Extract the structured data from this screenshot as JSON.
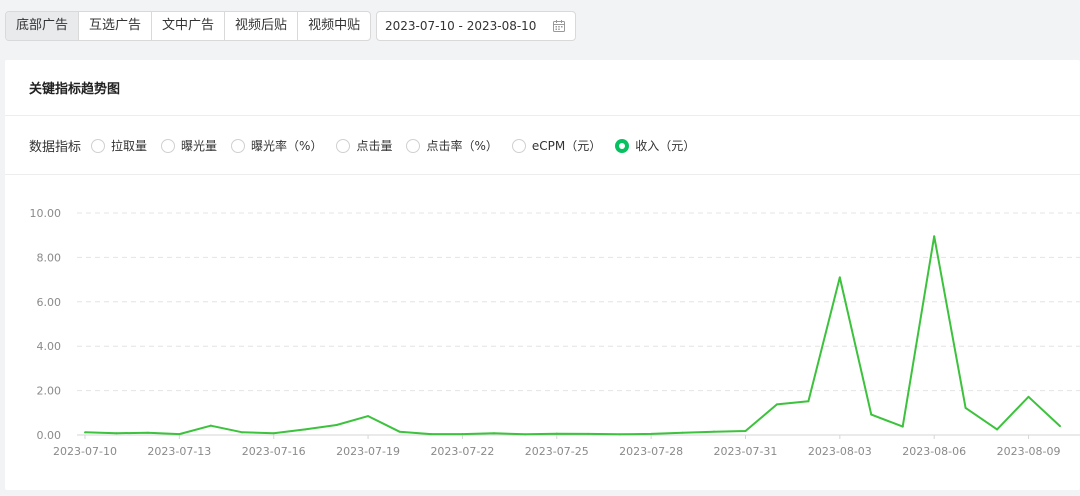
{
  "tabs": [
    {
      "label": "底部广告",
      "active": true
    },
    {
      "label": "互选广告",
      "active": false
    },
    {
      "label": "文中广告",
      "active": false
    },
    {
      "label": "视频后贴",
      "active": false
    },
    {
      "label": "视频中贴",
      "active": false
    }
  ],
  "daterange": {
    "value": "2023-07-10 - 2023-08-10",
    "icon": "calendar-icon"
  },
  "card": {
    "title": "关键指标趋势图"
  },
  "metrics": {
    "label": "数据指标",
    "options": [
      {
        "label": "拉取量",
        "checked": false
      },
      {
        "label": "曝光量",
        "checked": false
      },
      {
        "label": "曝光率（%）",
        "checked": false
      },
      {
        "label": "点击量",
        "checked": false
      },
      {
        "label": "点击率（%）",
        "checked": false
      },
      {
        "label": "eCPM（元）",
        "checked": false
      },
      {
        "label": "收入（元）",
        "checked": true
      }
    ]
  },
  "chart_data": {
    "type": "line",
    "x": [
      "2023-07-10",
      "2023-07-11",
      "2023-07-12",
      "2023-07-13",
      "2023-07-14",
      "2023-07-15",
      "2023-07-16",
      "2023-07-17",
      "2023-07-18",
      "2023-07-19",
      "2023-07-20",
      "2023-07-21",
      "2023-07-22",
      "2023-07-23",
      "2023-07-24",
      "2023-07-25",
      "2023-07-26",
      "2023-07-27",
      "2023-07-28",
      "2023-07-29",
      "2023-07-30",
      "2023-07-31",
      "2023-08-01",
      "2023-08-02",
      "2023-08-03",
      "2023-08-04",
      "2023-08-05",
      "2023-08-06",
      "2023-08-07",
      "2023-08-08",
      "2023-08-09",
      "2023-08-10"
    ],
    "xtick_labels": [
      "2023-07-10",
      "2023-07-13",
      "2023-07-16",
      "2023-07-19",
      "2023-07-22",
      "2023-07-25",
      "2023-07-28",
      "2023-07-31",
      "2023-08-03",
      "2023-08-06",
      "2023-08-09"
    ],
    "series": [
      {
        "values": [
          0.12,
          0.08,
          0.1,
          0.04,
          0.42,
          0.12,
          0.08,
          0.25,
          0.45,
          0.85,
          0.15,
          0.04,
          0.04,
          0.08,
          0.03,
          0.06,
          0.05,
          0.03,
          0.05,
          0.1,
          0.15,
          0.18,
          1.38,
          1.52,
          7.1,
          0.92,
          0.38,
          8.95,
          1.22,
          0.25,
          1.72,
          0.4
        ]
      }
    ],
    "ylim": [
      0,
      10
    ],
    "yticks": [
      "0.00",
      "2.00",
      "4.00",
      "6.00",
      "8.00",
      "10.00"
    ],
    "grid": true,
    "color": "#3cc23c"
  }
}
